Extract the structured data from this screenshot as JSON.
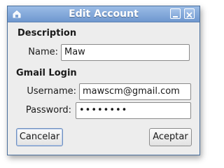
{
  "window": {
    "title": "Edit Account",
    "app_icon": "home-icon",
    "minimize_icon": "minimize-icon",
    "close_icon": "close-icon"
  },
  "description_section": {
    "heading": "Description",
    "name_label": "Name:",
    "name_value": "Maw"
  },
  "gmail_section": {
    "heading": "Gmail Login",
    "username_label": "Username:",
    "username_value": "mawscm@gmail.com",
    "password_label": "Password:",
    "password_value": "••••••••"
  },
  "buttons": {
    "cancel_label": "Cancelar",
    "accept_label": "Aceptar"
  }
}
